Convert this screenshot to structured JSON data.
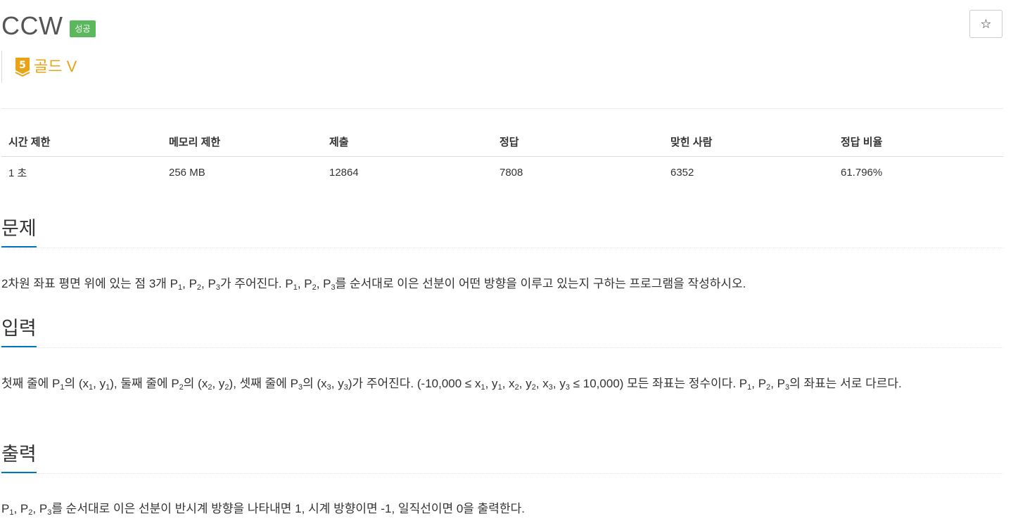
{
  "header": {
    "title": "CCW",
    "status": "성공",
    "star_icon": "star-icon",
    "tier_number": "5",
    "tier_label": "골드 V",
    "tier_color": "#e8a317",
    "status_color": "#5cb85c"
  },
  "info_table": {
    "headers": [
      "시간 제한",
      "메모리 제한",
      "제출",
      "정답",
      "맞힌 사람",
      "정답 비율"
    ],
    "values": [
      "1 초",
      "256 MB",
      "12864",
      "7808",
      "6352",
      "61.796%"
    ]
  },
  "sections": {
    "problem": {
      "heading": "문제",
      "text": {
        "s0": "2차원 좌표 평면 위에 있는 점 3개 P",
        "s1": ", P",
        "s2": ", P",
        "s3": "가 주어진다. P",
        "s4": ", P",
        "s5": ", P",
        "s6": "를 순서대로 이은 선분이 어떤 방향을 이루고 있는지 구하는 프로그램을 작성하시오."
      }
    },
    "input": {
      "heading": "입력",
      "text": {
        "s0": "첫째 줄에 P",
        "s1": "의 (x",
        "s2": ", y",
        "s3": "), 둘째 줄에 P",
        "s4": "의 (x",
        "s5": ", y",
        "s6": "), 셋째 줄에 P",
        "s7": "의 (x",
        "s8": ", y",
        "s9": ")가 주어진다. (-10,000 ≤ x",
        "s10": ", y",
        "s11": ", x",
        "s12": ", y",
        "s13": ", x",
        "s14": ", y",
        "s15": " ≤ 10,000) 모든 좌표는 정수이다. P",
        "s16": ", P",
        "s17": ", P",
        "s18": "의 좌표는 서로 다르다."
      }
    },
    "output": {
      "heading": "출력",
      "text": {
        "s0": "P",
        "s1": ", P",
        "s2": ", P",
        "s3": "를 순서대로 이은 선분이 반시계 방향을 나타내면 1, 시계 방향이면 -1, 일직선이면 0을 출력한다."
      }
    }
  },
  "subscripts": {
    "one": "1",
    "two": "2",
    "three": "3"
  },
  "accent_color": "#0076c0"
}
